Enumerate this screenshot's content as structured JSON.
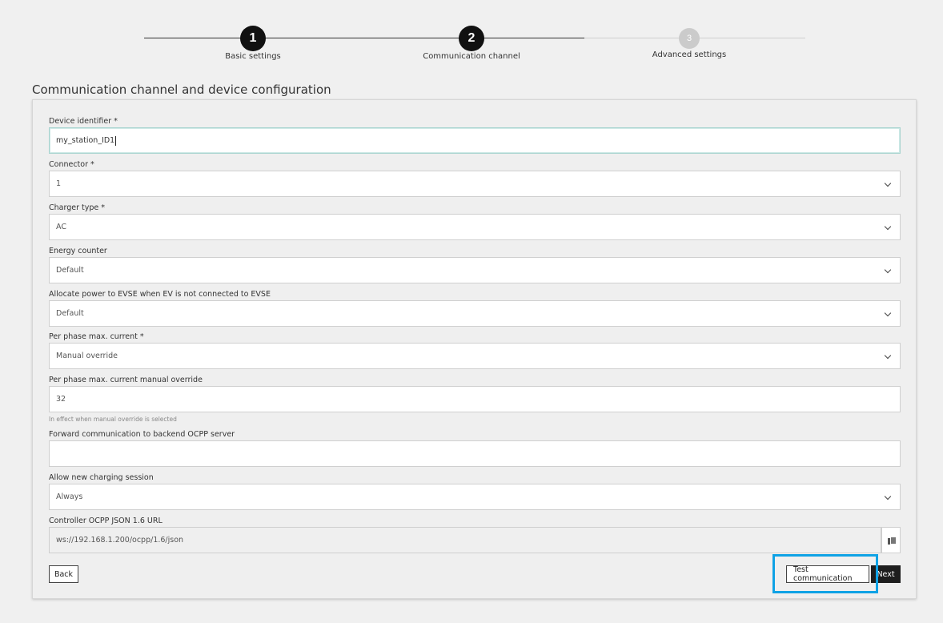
{
  "stepper": {
    "steps": [
      {
        "number": "1",
        "label": "Basic settings"
      },
      {
        "number": "2",
        "label": "Communication channel"
      },
      {
        "number": "3",
        "label": "Advanced settings"
      }
    ]
  },
  "page": {
    "title": "Communication channel and device configuration"
  },
  "form": {
    "device_identifier": {
      "label": "Device identifier *",
      "value": "my_station_ID1"
    },
    "connector": {
      "label": "Connector *",
      "value": "1"
    },
    "charger_type": {
      "label": "Charger type *",
      "value": "AC"
    },
    "energy_counter": {
      "label": "Energy counter",
      "value": "Default"
    },
    "allocate_power": {
      "label": "Allocate power to EVSE when EV is not connected to EVSE",
      "value": "Default"
    },
    "per_phase_max_current": {
      "label": "Per phase max. current *",
      "value": "Manual override"
    },
    "manual_override": {
      "label": "Per phase max. current manual override",
      "value": "32",
      "hint": "In effect when manual override is selected"
    },
    "forward_communication": {
      "label": "Forward communication to backend OCPP server",
      "value": ""
    },
    "allow_new_session": {
      "label": "Allow new charging session",
      "value": "Always"
    },
    "ocpp_url": {
      "label": "Controller OCPP JSON 1.6 URL",
      "value": "ws://192.168.1.200/ocpp/1.6/json"
    }
  },
  "buttons": {
    "back": "Back",
    "test_communication": "Test communication",
    "next": "Next"
  },
  "icons": {
    "copy": "copy-icon",
    "dropdown": "chevron-down-icon"
  },
  "colors": {
    "highlight": "#0fa2e5",
    "active_step": "#111111",
    "inactive_step": "#cbcbcb"
  }
}
